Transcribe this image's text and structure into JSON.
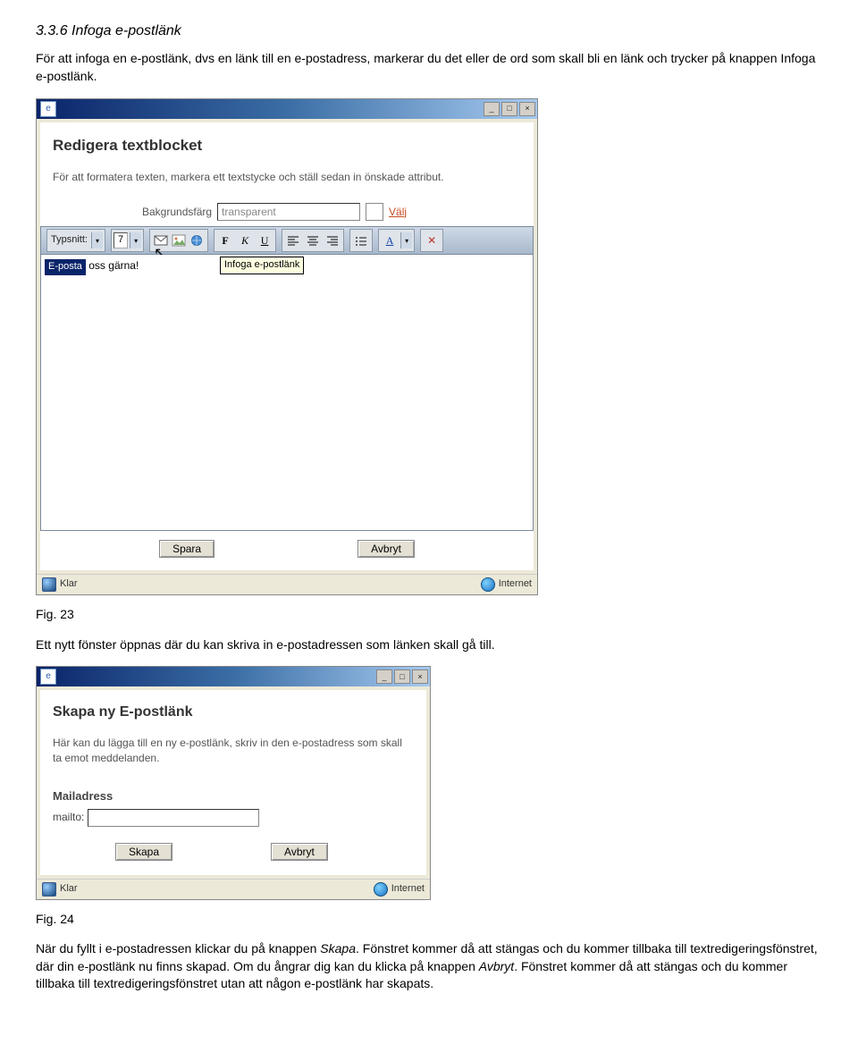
{
  "doc": {
    "section_number": "3.3.6",
    "section_title": "Infoga e-postlänk",
    "intro": "För att infoga en e-postlänk, dvs en länk till en e-postadress, markerar du det eller de ord som skall bli en länk och trycker på knappen Infoga e-postlänk.",
    "fig23": "Fig. 23",
    "after_fig23": "Ett nytt fönster öppnas där du kan skriva in e-postadressen som länken skall gå till.",
    "fig24": "Fig. 24",
    "closing_p1_a": "När du fyllt i e-postadressen klickar du på knappen ",
    "closing_p1_b": "Skapa",
    "closing_p1_c": ". Fönstret kommer då att stängas och du kommer tillbaka till textredigeringsfönstret, där din e-postlänk nu finns skapad. Om du ångrar dig kan du klicka på knappen ",
    "closing_p1_d": "Avbryt",
    "closing_p1_e": ". Fönstret kommer då att stängas och du kommer tillbaka till textredigeringsfönstret utan att någon e-postlänk har skapats."
  },
  "win1": {
    "dlg_title": "Redigera textblocket",
    "dlg_desc": "För att formatera texten, markera ett textstycke och ställ sedan in önskade attribut.",
    "bg_label": "Bakgrundsfärg",
    "bg_value": "transparent",
    "valj": "Välj",
    "font_label": "Typsnitt:",
    "font_size": "7",
    "editor_badge": "E-posta",
    "editor_text": " oss gärna!",
    "tooltip": "Infoga e-postlänk",
    "btn_save": "Spara",
    "btn_cancel": "Avbryt",
    "status_left": "Klar",
    "status_right": "Internet"
  },
  "win2": {
    "dlg_title": "Skapa ny E-postlänk",
    "dlg_desc": "Här kan du lägga till en ny e-postlänk, skriv in den e-postadress som skall ta emot meddelanden.",
    "field_label": "Mailadress",
    "mailto_label": "mailto:",
    "btn_create": "Skapa",
    "btn_cancel": "Avbryt",
    "status_left": "Klar",
    "status_right": "Internet"
  }
}
